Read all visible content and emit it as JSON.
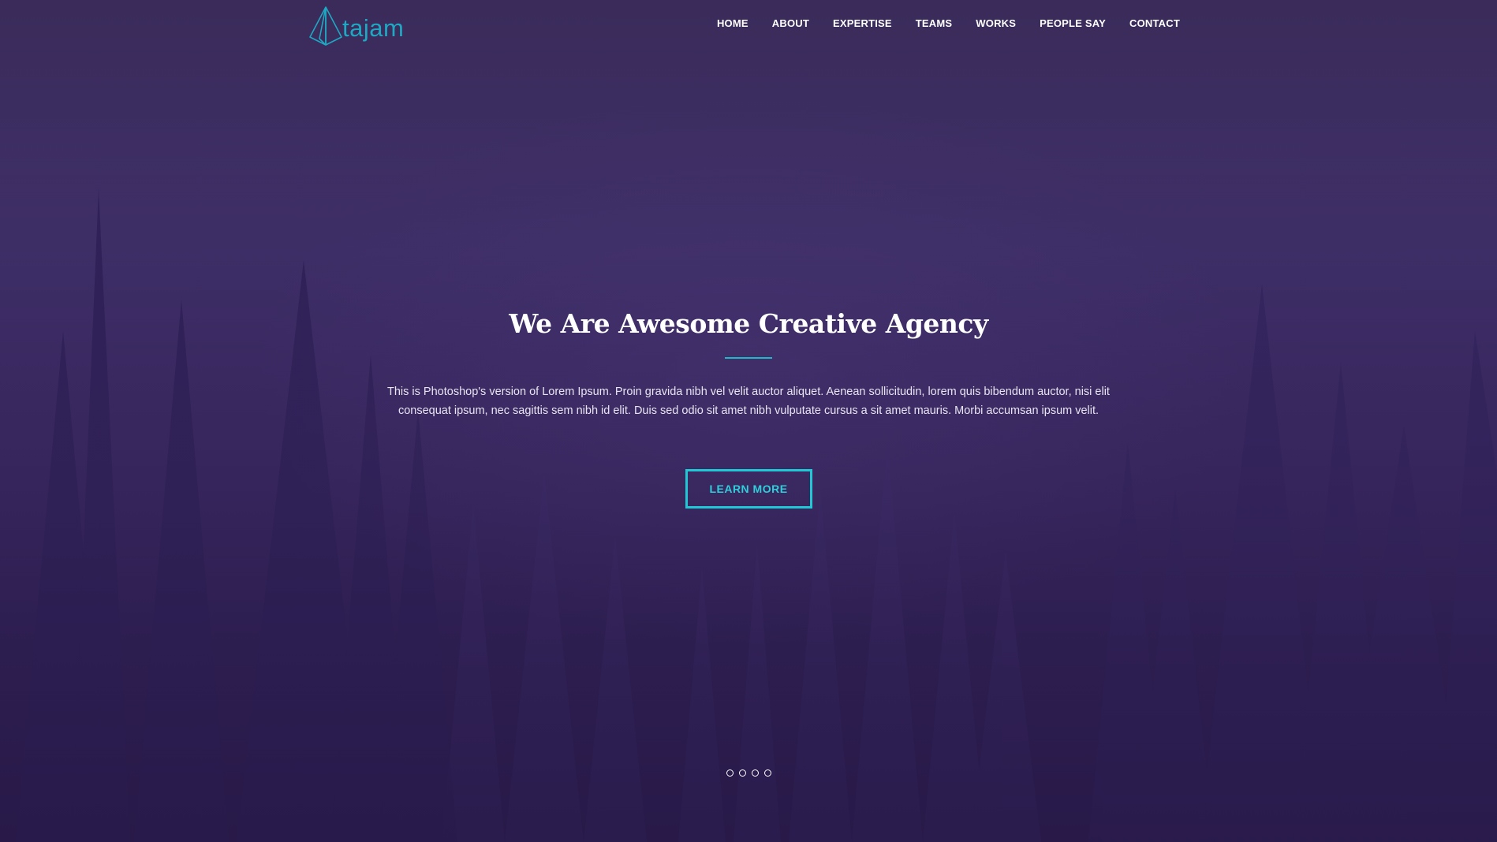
{
  "brand": {
    "name": "tajam",
    "logo_icon": "diamond-crystal-icon",
    "accent_color": "#1fa8c2"
  },
  "nav": {
    "items": [
      {
        "label": "HOME"
      },
      {
        "label": "ABOUT"
      },
      {
        "label": "EXPERTISE"
      },
      {
        "label": "TEAMS"
      },
      {
        "label": "WORKS"
      },
      {
        "label": "PEOPLE SAY"
      },
      {
        "label": "CONTACT"
      }
    ]
  },
  "hero": {
    "title": "We Are Awesome Creative Agency",
    "description": "This is Photoshop's version of Lorem Ipsum. Proin gravida nibh vel velit auctor aliquet. Aenean sollicitudin, lorem quis bibendum auctor, nisi elit consequat ipsum, nec sagittis sem nibh id elit. Duis sed odio sit amet nibh vulputate cursus a sit amet mauris. Morbi accumsan ipsum velit.",
    "cta_label": "LEARN MORE",
    "cta_color": "#1fc8d4",
    "background": "purple-forest-photo",
    "slider_dots": 4
  }
}
